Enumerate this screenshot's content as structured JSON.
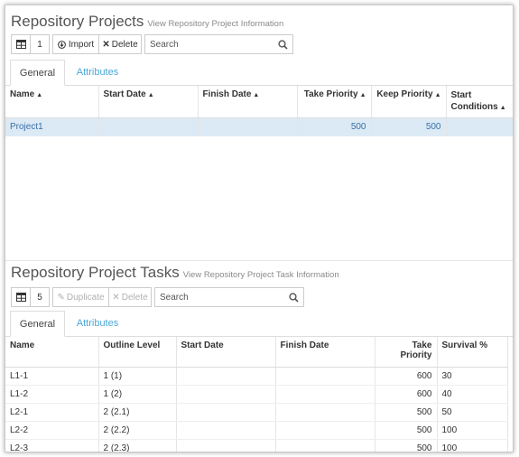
{
  "projects": {
    "title": "Repository Projects",
    "subtitle": "View Repository Project Information",
    "toolbar": {
      "count": "1",
      "import_label": "Import",
      "delete_label": "Delete",
      "search_placeholder": "Search"
    },
    "tabs": [
      "General",
      "Attributes"
    ],
    "columns": {
      "name": "Name",
      "start_date": "Start Date",
      "finish_date": "Finish Date",
      "take_priority": "Take Priority",
      "keep_priority": "Keep Priority",
      "start_conditions_1": "Start",
      "start_conditions_2": "Conditions"
    },
    "rows": [
      {
        "name": "Project1",
        "start_date": "",
        "finish_date": "",
        "take_priority": "500",
        "keep_priority": "500",
        "start_conditions": ""
      }
    ]
  },
  "tasks": {
    "title": "Repository Project Tasks",
    "subtitle": "View Repository Project Task Information",
    "toolbar": {
      "count": "5",
      "duplicate_label": "Duplicate",
      "delete_label": "Delete",
      "search_placeholder": "Search"
    },
    "tabs": [
      "General",
      "Attributes"
    ],
    "columns": {
      "name": "Name",
      "outline_level": "Outline Level",
      "start_date": "Start Date",
      "finish_date": "Finish Date",
      "take_priority": "Take Priority",
      "survival": "Survival %"
    },
    "rows": [
      {
        "name": "L1-1",
        "outline_level": "1 (1)",
        "take_priority": "600",
        "survival": "30"
      },
      {
        "name": "L1-2",
        "outline_level": "1 (2)",
        "take_priority": "600",
        "survival": "40"
      },
      {
        "name": "L2-1",
        "outline_level": "2 (2.1)",
        "take_priority": "500",
        "survival": "50"
      },
      {
        "name": "L2-2",
        "outline_level": "2 (2.2)",
        "take_priority": "500",
        "survival": "100"
      },
      {
        "name": "L2-3",
        "outline_level": "2 (2.3)",
        "take_priority": "500",
        "survival": "100"
      }
    ]
  },
  "colors": {
    "accent": "#4aa8d8",
    "selected_row": "#dceaf6",
    "selected_text": "#3a6ea5"
  }
}
